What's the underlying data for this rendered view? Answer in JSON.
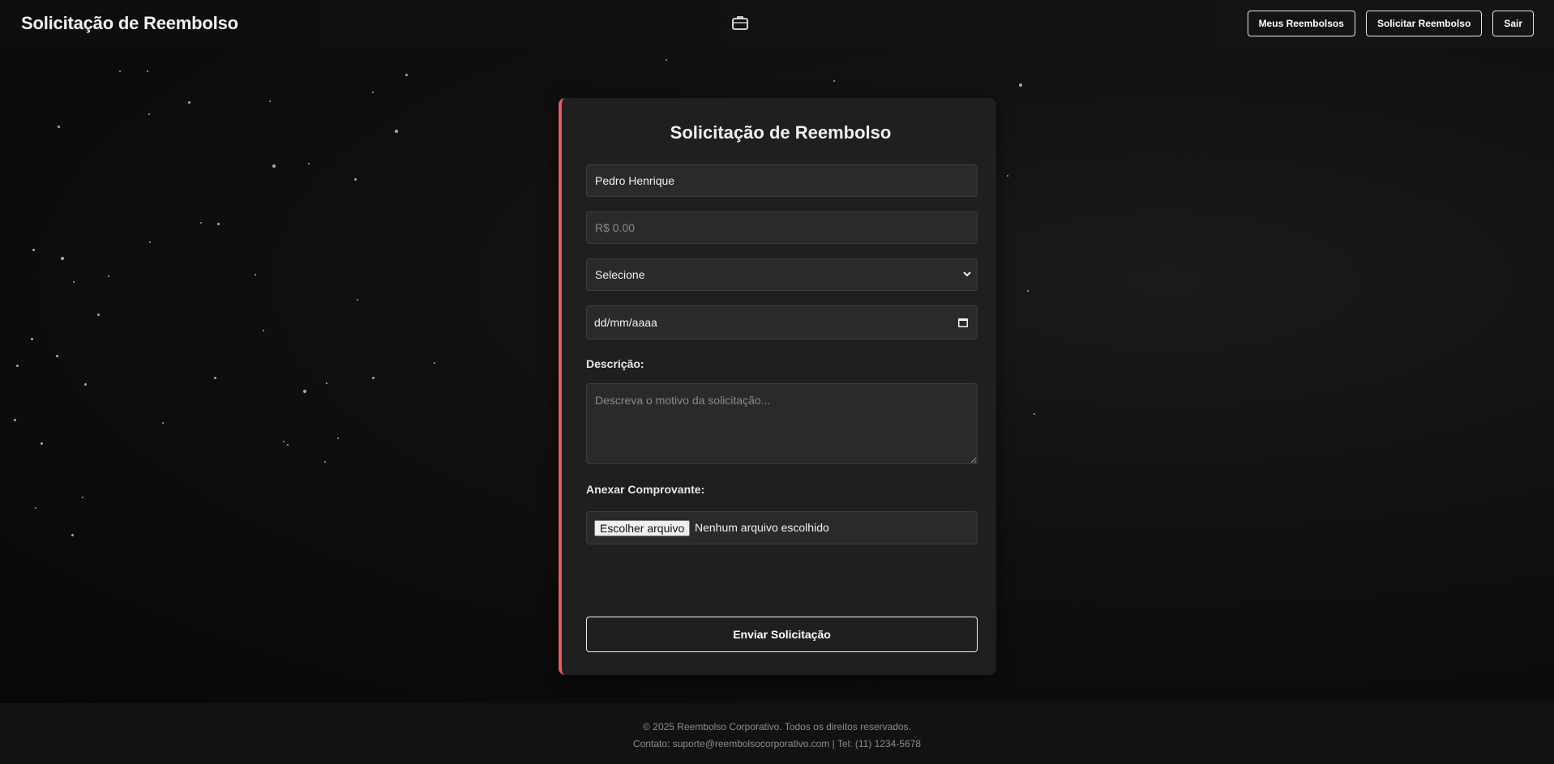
{
  "header": {
    "title": "Solicitação de Reembolso",
    "center_icon": "briefcase-icon",
    "nav": [
      {
        "label": "Meus Reembolsos"
      },
      {
        "label": "Solicitar Reembolso"
      },
      {
        "label": "Sair"
      }
    ]
  },
  "form": {
    "title": "Solicitação de Reembolso",
    "accent_color": "#e45c5c",
    "name_value": "Pedro Henrique",
    "amount_placeholder": "R$ 0.00",
    "category_selected": "Selecione",
    "date_placeholder": "dd/mm/aaaa",
    "description_label": "Descrição:",
    "description_placeholder": "Descreva o motivo da solicitação...",
    "attachment_label": "Anexar Comprovante:",
    "file_button": "Escolher arquivo",
    "file_status": "Nenhum arquivo escolhido",
    "submit_label": "Enviar Solicitação"
  },
  "footer": {
    "line1": "© 2025 Reembolso Corporativo. Todos os direitos reservados.",
    "line2": "Contato: suporte@reembolsocorporativo.com | Tel: (11) 1234-5678"
  }
}
